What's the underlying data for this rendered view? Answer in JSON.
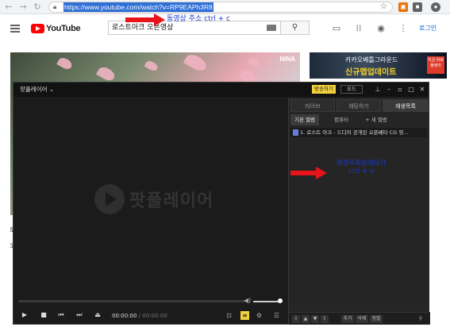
{
  "browser": {
    "url": "https://www.youtube.com/watch?v=RP9EAPh3R8",
    "nav": [
      "back-icon",
      "forward-icon",
      "reload-icon"
    ],
    "extensions": [
      {
        "name": "extension-orange-icon",
        "color": "#e8710a"
      },
      {
        "name": "extension-gray-icon",
        "color": "#5f6368"
      }
    ]
  },
  "youtube": {
    "logo_text": "YouTube",
    "search_value": "로스트아크 오픈영상",
    "login": "로그인"
  },
  "annotations": {
    "copy_hint": "동영상 주소 ctrl + c",
    "paste_hint_line1": "재생목록창에다가",
    "paste_hint_line2": "ctrl + v",
    "arrow_color": "#e8141c",
    "text_color": "#1a37c9"
  },
  "video": {
    "watermark": "NINA"
  },
  "ad": {
    "line1": "카카오배틀그라운드",
    "line2": "신규맵업데이트",
    "button": "지금 바로 플레이"
  },
  "player": {
    "title": "팟플레이어",
    "broadcast": "방송하기",
    "mode": "모드",
    "logo_text": "팟플레이어",
    "time_current": "00:00:00",
    "time_total": "/ 00:00:00",
    "panel_tabs": [
      "라이브",
      "채팅하기",
      "재생목록"
    ],
    "sub_tabs": [
      "기본 앨범",
      "컴퓨터",
      "+ 새 앨범"
    ],
    "playlist": [
      "1. 로스트 아크 - 드디어 공개된 오픈베타 CG 영..."
    ],
    "bottom_buttons": [
      "추가",
      "삭제",
      "정렬"
    ]
  },
  "page_fragments": [
    "로",
    "코"
  ]
}
